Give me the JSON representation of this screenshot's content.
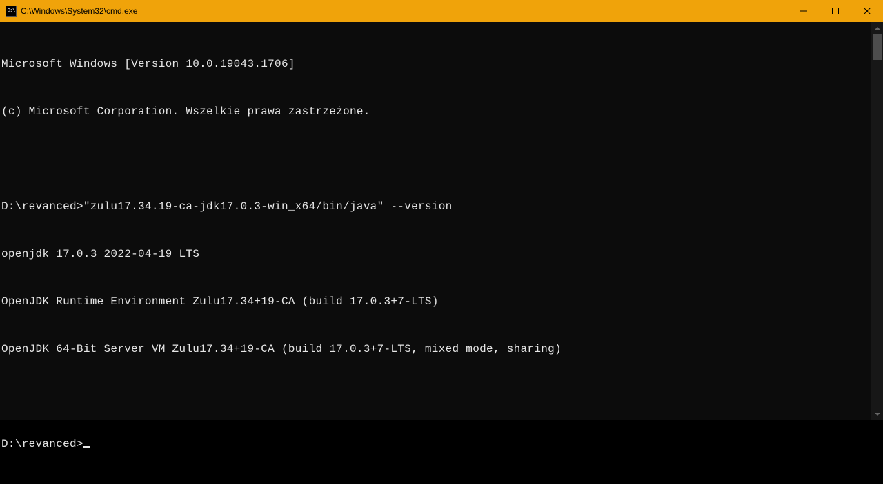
{
  "window": {
    "title": "C:\\Windows\\System32\\cmd.exe"
  },
  "terminal": {
    "lines": [
      "Microsoft Windows [Version 10.0.19043.1706]",
      "(c) Microsoft Corporation. Wszelkie prawa zastrzeżone.",
      "",
      "D:\\revanced>\"zulu17.34.19-ca-jdk17.0.3-win_x64/bin/java\" --version",
      "openjdk 17.0.3 2022-04-19 LTS",
      "OpenJDK Runtime Environment Zulu17.34+19-CA (build 17.0.3+7-LTS)",
      "OpenJDK 64-Bit Server VM Zulu17.34+19-CA (build 17.0.3+7-LTS, mixed mode, sharing)",
      ""
    ],
    "prompt": "D:\\revanced>"
  }
}
